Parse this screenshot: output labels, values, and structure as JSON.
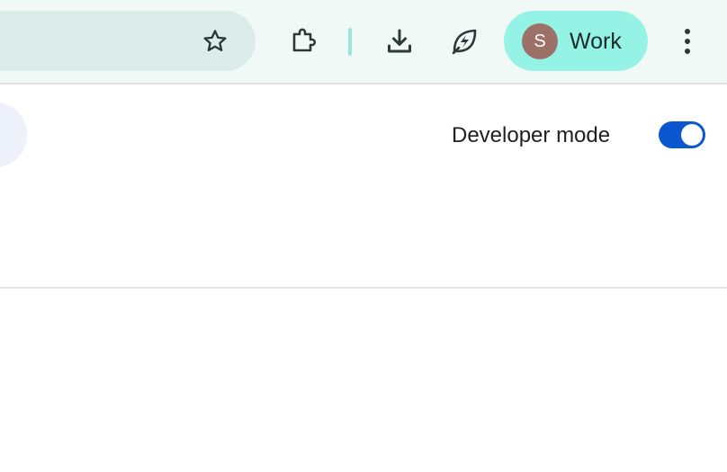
{
  "toolbar": {
    "icons": {
      "bookmark": "star-icon",
      "extensions": "puzzle-icon",
      "downloads": "download-icon",
      "performance": "leaf-bolt-icon",
      "menu": "three-dot-menu-icon"
    },
    "profile": {
      "initial": "S",
      "name": "Work",
      "avatar_color": "#9d7168",
      "chip_color": "#94f3e5"
    }
  },
  "page": {
    "developer_mode": {
      "label": "Developer mode",
      "enabled": true,
      "accent_color": "#0b57d0"
    }
  }
}
